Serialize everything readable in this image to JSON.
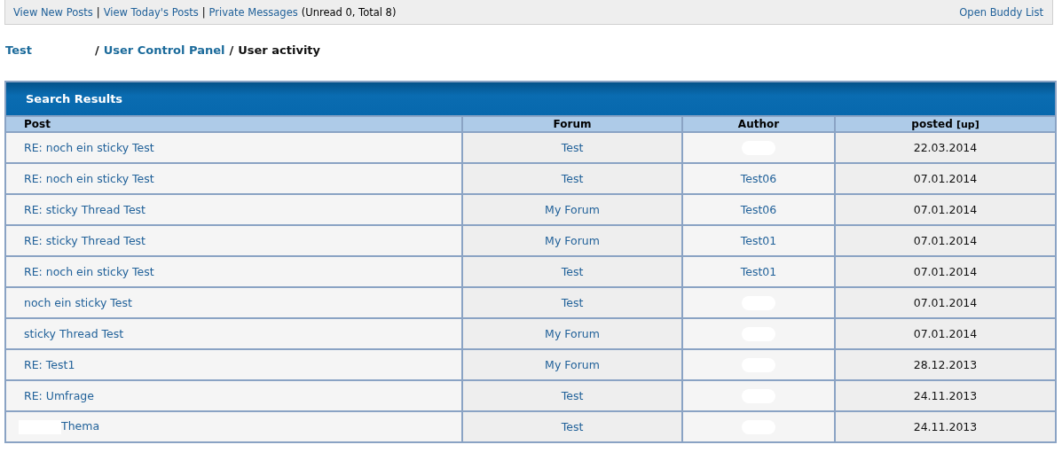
{
  "top_bar": {
    "links": [
      {
        "label": "View New Posts"
      },
      {
        "label": "View Today's Posts"
      },
      {
        "label": "Private Messages"
      }
    ],
    "separator": "|",
    "message_count": "(Unread 0, Total 8)",
    "buddy_link": "Open Buddy List"
  },
  "breadcrumb": {
    "separator": "/",
    "items": [
      {
        "label": "Test",
        "link": true
      },
      {
        "label": "User Control Panel",
        "link": true
      },
      {
        "label": "User activity",
        "link": false
      }
    ]
  },
  "panel": {
    "title": "Search Results"
  },
  "table": {
    "columns": [
      {
        "label": "Post"
      },
      {
        "label": "Forum"
      },
      {
        "label": "Author"
      },
      {
        "label": "posted",
        "sort": "[up]"
      }
    ],
    "rows": [
      {
        "post": "RE: noch ein sticky Test",
        "forum": "Test",
        "posted": "22.03.2014"
      },
      {
        "post": "RE: noch ein sticky Test",
        "forum": "Test",
        "author": "Test06",
        "posted": "07.01.2014"
      },
      {
        "post": "RE: sticky Thread Test",
        "forum": "My Forum",
        "author": "Test06",
        "posted": "07.01.2014"
      },
      {
        "post": "RE: sticky Thread Test",
        "forum": "My Forum",
        "author": "Test01",
        "posted": "07.01.2014"
      },
      {
        "post": "RE: noch ein sticky Test",
        "forum": "Test",
        "author": "Test01",
        "posted": "07.01.2014"
      },
      {
        "post": "noch ein sticky Test",
        "forum": "Test",
        "posted": "07.01.2014"
      },
      {
        "post": "sticky Thread Test",
        "forum": "My Forum",
        "posted": "07.01.2014"
      },
      {
        "post": "RE: Test1",
        "forum": "My Forum",
        "posted": "28.12.2013"
      },
      {
        "post": "RE: Umfrage",
        "forum": "Test",
        "posted": "24.11.2013"
      },
      {
        "post": "Thema",
        "post_prefix_redacted": true,
        "forum": "Test",
        "posted": "24.11.2013"
      }
    ]
  }
}
